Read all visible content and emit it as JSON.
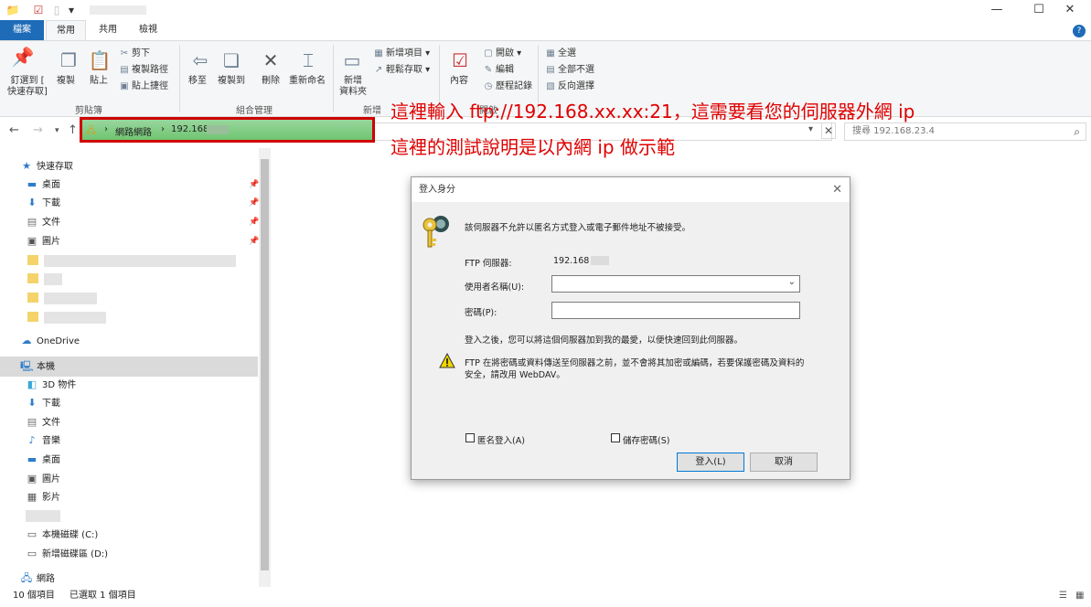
{
  "window": {
    "minimize_glyph": "—",
    "maximize_glyph": "☐",
    "close_glyph": "✕",
    "quick_access_glyphs": [
      "📁",
      "☑",
      "▯",
      "▾"
    ]
  },
  "ribbon_tabs": {
    "file": "檔案",
    "home": "常用",
    "share": "共用",
    "view": "檢視",
    "help": "?"
  },
  "ribbon": {
    "pin_quick_access": [
      "釘選到 [",
      "快速存取]"
    ],
    "copy": "複製",
    "paste": "貼上",
    "cut": "剪下",
    "copy_path": "複製路徑",
    "paste_shortcut": "貼上捷徑",
    "clipboard_group": "剪貼簿",
    "move_to": "移至",
    "copy_to": "複製到",
    "delete": "刪除",
    "rename": "重新命名",
    "organize_group": "組合管理",
    "new_folder": [
      "新增",
      "資料夾"
    ],
    "new_item": "新增項目",
    "easy_access": "輕鬆存取",
    "new_group": "新增",
    "properties": "內容",
    "open": "開啟",
    "edit": "編輯",
    "history": "歷程記錄",
    "open_group": "開啟",
    "select_all": "全選",
    "select_none": "全部不選",
    "invert_selection": "反向選擇"
  },
  "address_bar": {
    "crumb_network": "網路網路",
    "crumb_host": "192.168",
    "search_placeholder": "搜尋 192.168.23.4"
  },
  "instructions": [
    "這裡輸入 ftp://192.168.xx.xx:21，這需要看您的伺服器外網 ip",
    "這裡的測試說明是以內網 ip 做示範"
  ],
  "nav": {
    "quick_access": "快速存取",
    "qa_items": [
      "桌面",
      "下載",
      "文件",
      "圖片"
    ],
    "onedrive": "OneDrive",
    "this_pc": "本機",
    "pc_items": [
      "3D 物件",
      "下載",
      "文件",
      "音樂",
      "桌面",
      "圖片",
      "影片"
    ],
    "drive_c": "本機磁碟 (C:)",
    "drive_d": "新增磁碟區 (D:)",
    "network": "網路"
  },
  "status": {
    "item_count": "10 個項目",
    "selected": "已選取 1 個項目"
  },
  "dialog": {
    "title": "登入身分",
    "message": "該伺服器不允許以匿名方式登入或電子郵件地址不被接受。",
    "ftp_server_label": "FTP 伺服器:",
    "ftp_server_value": "192.168",
    "username_label": "使用者名稱(U):",
    "password_label": "密碼(P):",
    "after_login": "登入之後，您可以將這個伺服器加到我的最愛，以便快速回到此伺服器。",
    "warning_line1": "FTP 在將密碼或資料傳送至伺服器之前，並不會將其加密或編碼，若要保護密碼及資料的",
    "warning_line2": "安全，請改用 WebDAV。",
    "anonymous": "匿名登入(A)",
    "save_password": "儲存密碼(S)",
    "login_button": "登入(L)",
    "cancel_button": "取消"
  }
}
